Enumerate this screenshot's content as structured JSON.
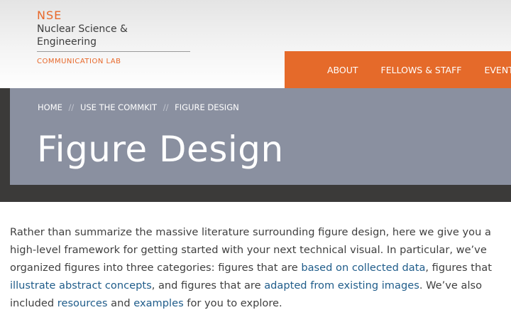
{
  "logo": {
    "short": "NSE",
    "name": "Nuclear Science & Engineering",
    "sub": "COMMUNICATION LAB"
  },
  "nav": {
    "items": [
      {
        "label": "ABOUT"
      },
      {
        "label": "FELLOWS & STAFF"
      },
      {
        "label": "EVENTS"
      }
    ]
  },
  "breadcrumb": {
    "items": [
      "HOME",
      "USE THE COMMKIT",
      "FIGURE DESIGN"
    ],
    "separator": "//"
  },
  "page": {
    "title": "Figure Design"
  },
  "intro": {
    "t1": "Rather than summarize the massive literature surrounding figure design, here we give you a high-level framework for getting started with your next technical visual. In particular, we’ve organized figures into three categories: figures that are ",
    "link1": "based on collected data",
    "t2": ", figures that ",
    "link2": "illustrate abstract concepts",
    "t3": ", and figures that are ",
    "link3": "adapted from existing images",
    "t4": ". We’ve also included ",
    "link4": "resources",
    "t5": " and ",
    "link5": "examples",
    "t6": " for you to explore."
  },
  "colors": {
    "brand_orange": "#e56a2a",
    "hero_band": "#8a90a0",
    "hero_shadow": "#3b3a39",
    "link": "#1f5c8a"
  }
}
